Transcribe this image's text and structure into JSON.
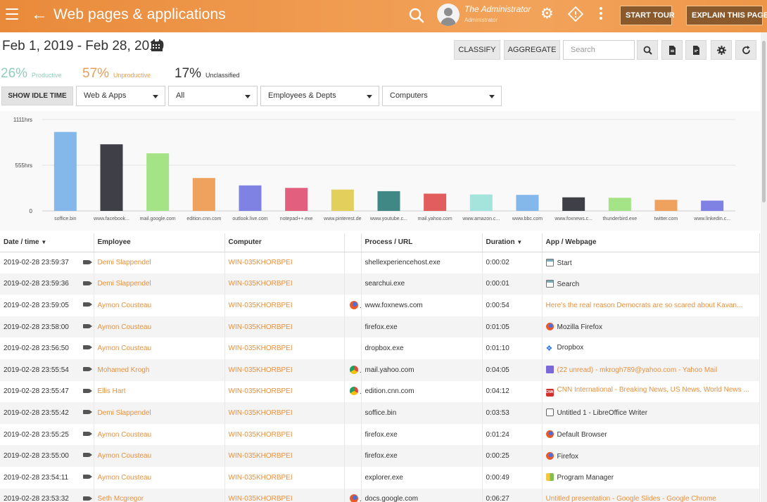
{
  "header": {
    "title": "Web pages & applications",
    "back_icon": "back-arrow-icon",
    "user_name": "The Administrator",
    "user_role": "Administrator",
    "start_tour": "START TOUR",
    "explain": "EXPLAIN THIS PAGE",
    "accent": "#ef9a4f"
  },
  "toolbar": {
    "date_range": "Feb 1, 2019 - Feb 28, 2019",
    "classify": "CLASSIFY",
    "aggregate": "AGGREGATE",
    "search_placeholder": "Search"
  },
  "stats": {
    "productive": {
      "value": "26%",
      "label": "Productive",
      "color": "#8fcfb7"
    },
    "unproductive": {
      "value": "57%",
      "label": "Unproductive",
      "color": "#e89e57"
    },
    "unclassified": {
      "value": "17%",
      "label": "Unclassified",
      "color": "#333333"
    }
  },
  "filters": {
    "idle": "SHOW IDLE TIME",
    "type": "Web & Apps",
    "scope": "All",
    "employees": "Employees & Depts",
    "computers": "Computers"
  },
  "chart_data": {
    "type": "bar",
    "yticks": [
      "1111hrs",
      "555hrs",
      "0"
    ],
    "ylim": [
      0,
      1111
    ],
    "categories": [
      "soffice.bin",
      "www.facebook...",
      "mail.google.com",
      "edition.cnn.com",
      "outlook.live.com",
      "notepad++.exe",
      "www.pinterest.de",
      "www.youtube.c...",
      "mail.yahoo.com",
      "www.amazon.c...",
      "www.bbc.com",
      "www.foxnews.c...",
      "thunderbird.exe",
      "twitter.com",
      "www.linkedin.c..."
    ],
    "values": [
      960,
      810,
      700,
      400,
      310,
      280,
      260,
      240,
      210,
      200,
      195,
      165,
      160,
      135,
      125
    ],
    "colors": [
      "#84b7ea",
      "#3f3f47",
      "#a4e487",
      "#eea25e",
      "#7f82e3",
      "#e25f7d",
      "#e3d05c",
      "#3f8886",
      "#e25d5d",
      "#a4e4dc",
      "#84b7ea",
      "#3f3f47",
      "#a4e487",
      "#eea25e",
      "#7f82e3"
    ]
  },
  "table": {
    "columns": [
      "Date / time",
      "Employee",
      "Computer",
      "",
      "Process / URL",
      "Duration",
      "App / Webpage"
    ],
    "sort_marks": {
      "date": "▼",
      "duration": "▼"
    },
    "rows": [
      {
        "date": "2019-02-28 23:59:37",
        "employee": "Demi Slappendel",
        "computer": "WIN-035KHORBPEI",
        "browser": "",
        "process": "shellexperiencehost.exe",
        "duration": "0:00:02",
        "app": "Start",
        "app_icon": "window-icon",
        "highlight": false
      },
      {
        "date": "2019-02-28 23:59:36",
        "employee": "Demi Slappendel",
        "computer": "WIN-035KHORBPEI",
        "browser": "",
        "process": "searchui.exe",
        "duration": "0:00:01",
        "app": "Search",
        "app_icon": "window-icon",
        "highlight": false
      },
      {
        "date": "2019-02-28 23:59:05",
        "employee": "Aymon Cousteau",
        "computer": "WIN-035KHORBPEI",
        "browser": "firefox",
        "process": "www.foxnews.com",
        "duration": "0:00:54",
        "app": "Here's the real reason Democrats are so scared about Kavan...",
        "app_icon": "",
        "highlight": true
      },
      {
        "date": "2019-02-28 23:58:00",
        "employee": "Aymon Cousteau",
        "computer": "WIN-035KHORBPEI",
        "browser": "",
        "process": "firefox.exe",
        "duration": "0:01:05",
        "app": "Mozilla Firefox",
        "app_icon": "firefox-icon",
        "highlight": false
      },
      {
        "date": "2019-02-28 23:56:50",
        "employee": "Aymon Cousteau",
        "computer": "WIN-035KHORBPEI",
        "browser": "",
        "process": "dropbox.exe",
        "duration": "0:01:10",
        "app": "Dropbox",
        "app_icon": "dropbox-icon",
        "highlight": false
      },
      {
        "date": "2019-02-28 23:55:54",
        "employee": "Mohamed Krogh",
        "computer": "WIN-035KHORBPEI",
        "browser": "chrome",
        "process": "mail.yahoo.com",
        "duration": "0:04:05",
        "app": "(22 unread) - mkrogh789@yahoo.com - Yahoo Mail",
        "app_icon": "mail-icon",
        "highlight": true
      },
      {
        "date": "2019-02-28 23:55:47",
        "employee": "Ellis Hart",
        "computer": "WIN-035KHORBPEI",
        "browser": "chrome",
        "process": "edition.cnn.com",
        "duration": "0:04:12",
        "app": "CNN International - Breaking News, US News, World News ...",
        "app_icon": "cnn-icon",
        "highlight": true
      },
      {
        "date": "2019-02-28 23:55:42",
        "employee": "Demi Slappendel",
        "computer": "WIN-035KHORBPEI",
        "browser": "",
        "process": "soffice.bin",
        "duration": "0:03:53",
        "app": "Untitled 1 - LibreOffice Writer",
        "app_icon": "document-icon",
        "highlight": false
      },
      {
        "date": "2019-02-28 23:55:25",
        "employee": "Aymon Cousteau",
        "computer": "WIN-035KHORBPEI",
        "browser": "",
        "process": "firefox.exe",
        "duration": "0:01:24",
        "app": "Default Browser",
        "app_icon": "firefox-icon",
        "highlight": false
      },
      {
        "date": "2019-02-28 23:55:00",
        "employee": "Aymon Cousteau",
        "computer": "WIN-035KHORBPEI",
        "browser": "",
        "process": "firefox.exe",
        "duration": "0:00:25",
        "app": "Firefox",
        "app_icon": "firefox-icon",
        "highlight": false
      },
      {
        "date": "2019-02-28 23:54:11",
        "employee": "Aymon Cousteau",
        "computer": "WIN-035KHORBPEI",
        "browser": "",
        "process": "explorer.exe",
        "duration": "0:00:49",
        "app": "Program Manager",
        "app_icon": "program-manager-icon",
        "highlight": false
      },
      {
        "date": "2019-02-28 23:53:32",
        "employee": "Seth Mcgregor",
        "computer": "WIN-035KHORBPEI",
        "browser": "firefox",
        "process": "docs.google.com",
        "duration": "0:06:27",
        "app": "Untitled presentation - Google Slides - Google Chrome",
        "app_icon": "",
        "highlight": true
      }
    ]
  }
}
